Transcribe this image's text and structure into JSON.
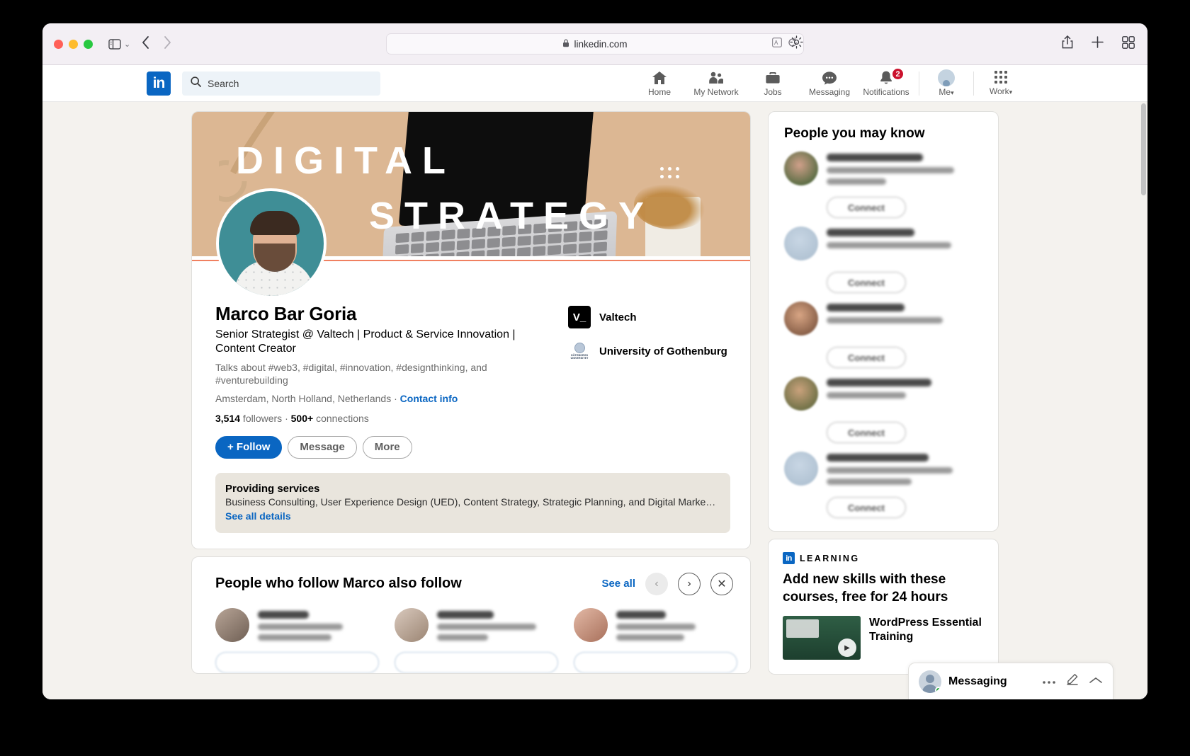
{
  "browser": {
    "url": "linkedin.com",
    "lock_icon": "lock-icon",
    "traffic_lights": [
      "close",
      "minimize",
      "zoom"
    ],
    "back_icon": "back-arrow-icon",
    "forward_icon": "forward-arrow-icon",
    "sidebar_icon": "sidebar-toggle-icon",
    "shield_icon": "privacy-shield-icon",
    "bookmark_icon": "star-icon",
    "translate_icon": "translate-icon",
    "reload_icon": "reload-icon",
    "settings_icon": "gear-icon",
    "share_icon": "share-icon",
    "newtab_icon": "plus-icon",
    "tabs_icon": "tab-overview-icon"
  },
  "topnav": {
    "logo": "in",
    "search_placeholder": "Search",
    "items": [
      {
        "label": "Home",
        "icon": "home-icon"
      },
      {
        "label": "My Network",
        "icon": "people-icon"
      },
      {
        "label": "Jobs",
        "icon": "briefcase-icon"
      },
      {
        "label": "Messaging",
        "icon": "chat-icon"
      },
      {
        "label": "Notifications",
        "icon": "bell-icon",
        "badge": "2"
      }
    ],
    "me": {
      "label": "Me",
      "caret": "▾"
    },
    "work": {
      "label": "Work",
      "caret": "▾"
    }
  },
  "banner": {
    "line1": "DIGITAL",
    "line2": "STRATEGY",
    "highlight_color": "#f08060"
  },
  "profile": {
    "name": "Marco Bar Goria",
    "headline": "Senior Strategist @ Valtech | Product & Service Innovation | Content Creator",
    "talks_about": "Talks about #web3, #digital, #innovation, #designthinking, and #venturebuilding",
    "location": "Amsterdam, North Holland, Netherlands · ",
    "contact_info": "Contact info",
    "followers": "3,514",
    "followers_label": " followers ",
    "separator": "· ",
    "connections": "500+",
    "connections_label": " connections",
    "buttons": {
      "follow": "+ Follow",
      "message": "Message",
      "more": "More"
    },
    "orgs": [
      {
        "name": "Valtech",
        "logo_text": "V_",
        "logo_type": "valtech"
      },
      {
        "name": "University of Gothenburg",
        "logo_text": "GÖTEBORGS UNIVERSITET",
        "logo_type": "uni"
      }
    ]
  },
  "services": {
    "title": "Providing services",
    "description": "Business Consulting, User Experience Design (UED), Content Strategy, Strategic Planning, and Digital Marke…",
    "link": "See all details"
  },
  "follow_also": {
    "title": "People who follow Marco also follow",
    "see_all": "See all",
    "prev_icon": "chevron-left-icon",
    "next_icon": "chevron-right-icon",
    "close_icon": "close-icon",
    "items": [
      {
        "name": "Helen S.",
        "desc": "The Big Brick",
        "meta": "837,620 followers"
      },
      {
        "name": "Olga Kozina",
        "desc": "Freelance IT Recruiter /…",
        "meta": "896 followers"
      },
      {
        "name": "Heather …",
        "desc": "Recruiter…",
        "meta": "112,175 followers"
      }
    ]
  },
  "sidebar": {
    "pymk_title": "People you may know",
    "people": [
      {
        "name": "Robert Rusperiam",
        "title": "Senior Technical Support Specialist - Symbion",
        "connect": "Connect"
      },
      {
        "name": "Evgeny Martynov",
        "title": "IT Support Specialist - Buckenbieq",
        "connect": "Connect"
      },
      {
        "name": "Vladimir Ivanov",
        "title": "Endpoint Support Specialist II",
        "connect": "Connect"
      },
      {
        "name": "Grigorii Bogolioubov",
        "title": "IT Support Specialist",
        "connect": "Connect"
      },
      {
        "name": "Vyacheslav Zhuravlev",
        "title": "Technical Support Specialist at Honeywell Analytics",
        "connect": "Connect"
      }
    ],
    "learning": {
      "brand": "in",
      "label": "LEARNING",
      "title": "Add new skills with these courses, free for 24 hours",
      "course": "WordPress Essential Training",
      "play_icon": "play-icon"
    }
  },
  "messaging_dock": {
    "title": "Messaging",
    "more_icon": "ellipsis-icon",
    "compose_icon": "compose-icon",
    "expand_icon": "chevron-up-icon",
    "online_status": "online"
  }
}
